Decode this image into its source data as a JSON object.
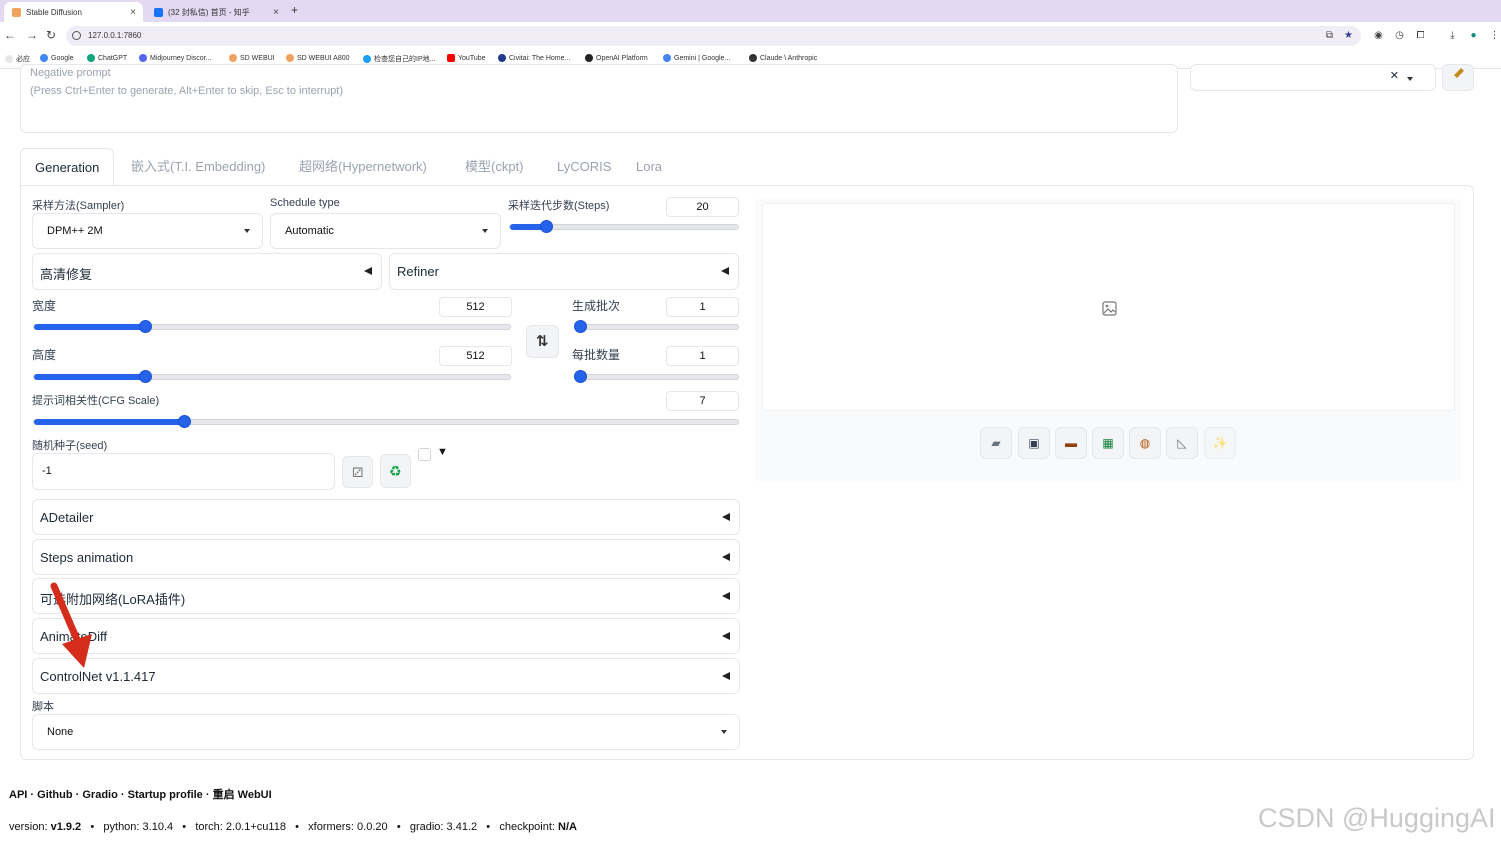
{
  "browser": {
    "tabs": [
      {
        "title": "Stable Diffusion",
        "active": true
      },
      {
        "title": "(32 封私信) 首页 - 知乎",
        "active": false
      }
    ],
    "new_tab": "+",
    "url": "127.0.0.1:7860",
    "bookmarks": [
      "必应",
      "Google",
      "ChatGPT",
      "Midjourney Discor...",
      "SD WEBUI",
      "SD WEBUI A800",
      "检查您自己的IP地...",
      "YouTube",
      "Civitai: The Home...",
      "OpenAI Platform",
      "Gemini | Google...",
      "Claude \\ Anthropic"
    ]
  },
  "prompt": {
    "negative_placeholder_line1": "Negative prompt",
    "negative_placeholder_line2": "(Press Ctrl+Enter to generate, Alt+Enter to skip, Esc to interrupt)"
  },
  "styles_close": "✕",
  "tabs": [
    "Generation",
    "嵌入式(T.I. Embedding)",
    "超网络(Hypernetwork)",
    "模型(ckpt)",
    "LyCORIS",
    "Lora"
  ],
  "sampler": {
    "label": "采样方法(Sampler)",
    "value": "DPM++ 2M"
  },
  "schedule": {
    "label": "Schedule type",
    "value": "Automatic"
  },
  "steps": {
    "label": "采样迭代步数(Steps)",
    "value": "20",
    "fraction": 0.16
  },
  "hires": {
    "label": "高清修复"
  },
  "refiner": {
    "label": "Refiner"
  },
  "width": {
    "label": "宽度",
    "value": "512",
    "fraction": 0.233
  },
  "height": {
    "label": "高度",
    "value": "512",
    "fraction": 0.233
  },
  "batch_count": {
    "label": "生成批次",
    "value": "1",
    "fraction": 0.0
  },
  "batch_size": {
    "label": "每批数量",
    "value": "1",
    "fraction": 0.0
  },
  "cfg": {
    "label": "提示词相关性(CFG Scale)",
    "value": "7",
    "fraction": 0.213
  },
  "seed": {
    "label": "随机种子(seed)",
    "value": "-1",
    "extra_toggle": "▼"
  },
  "accordions": [
    "ADetailer",
    "Steps animation",
    "可选附加网络(LoRA插件)",
    "AnimateDiff",
    "ControlNet v1.1.417"
  ],
  "script": {
    "label": "脚本",
    "value": "None"
  },
  "footer": {
    "links": [
      "API",
      "Github",
      "Gradio",
      "Startup profile",
      "重启 WebUI"
    ],
    "version_label": "version:",
    "version": "v1.9.2",
    "python": "python: 3.10.4",
    "torch": "torch: 2.0.1+cu118",
    "xformers": "xformers: 0.0.20",
    "gradio": "gradio: 3.41.2",
    "checkpoint_label": "checkpoint:",
    "checkpoint": "N/A"
  },
  "watermark": "CSDN @HuggingAI",
  "colors": {
    "accent": "#2563eb",
    "annotation_arrow": "#d42d1c",
    "tab_strip": "#e3d9f3"
  }
}
